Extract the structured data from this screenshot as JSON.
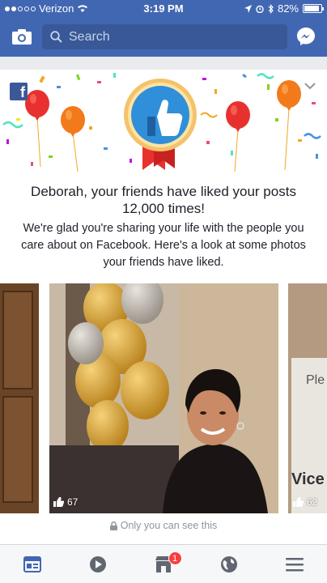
{
  "status_bar": {
    "carrier": "Verizon",
    "time": "3:19 PM",
    "battery": "82%"
  },
  "header": {
    "search_placeholder": "Search"
  },
  "memory_card": {
    "headline": "Deborah, your friends have liked your posts 12,000 times!",
    "body": "We're glad you're sharing your life with the people you care about on Facebook. Here's a look at some photos your friends have liked.",
    "privacy_note": "Only you can see this"
  },
  "photos": [
    {
      "likes": ""
    },
    {
      "likes": "67"
    },
    {
      "likes": "62",
      "sign_text_top": "Ple",
      "sign_text_bottom": "Vice"
    }
  ],
  "bottom_nav": {
    "items": [
      "news-feed",
      "watch",
      "marketplace",
      "notifications",
      "menu"
    ],
    "marketplace_badge": "1"
  },
  "colors": {
    "brand": "#4267b2",
    "search_bg": "#385898",
    "badge": "#fa3e3e",
    "active_tab": "#4267b2"
  }
}
